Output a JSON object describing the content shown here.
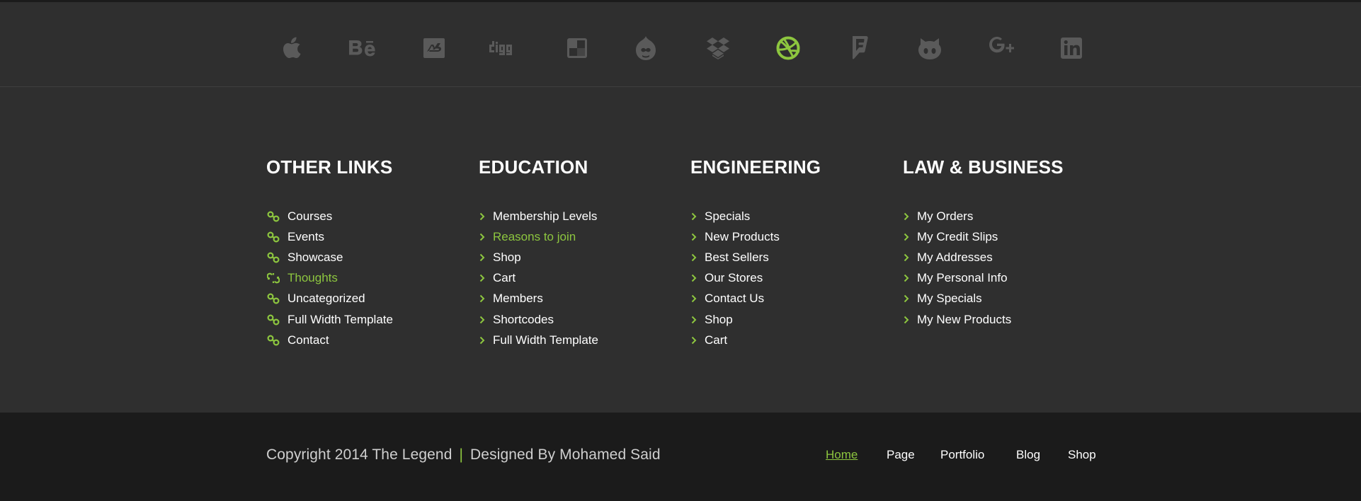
{
  "social": {
    "colors": {
      "default": "#5a5a5a",
      "active": "#8dc63f"
    },
    "icons": [
      {
        "name": "apple-icon",
        "active": false
      },
      {
        "name": "behance-icon",
        "active": false
      },
      {
        "name": "deviantart-icon",
        "active": false
      },
      {
        "name": "digg-icon",
        "active": false
      },
      {
        "name": "delicious-icon",
        "active": false
      },
      {
        "name": "drupal-icon",
        "active": false
      },
      {
        "name": "dropbox-icon",
        "active": false
      },
      {
        "name": "dribbble-icon",
        "active": true
      },
      {
        "name": "foursquare-icon",
        "active": false
      },
      {
        "name": "github-icon",
        "active": false
      },
      {
        "name": "google-plus-icon",
        "active": false
      },
      {
        "name": "linkedin-icon",
        "active": false
      }
    ]
  },
  "columns": [
    {
      "title": "OTHER LINKS",
      "icon": "chain-link-icon",
      "items": [
        {
          "label": "Courses",
          "active": false
        },
        {
          "label": "Events",
          "active": false
        },
        {
          "label": "Showcase",
          "active": false
        },
        {
          "label": "Thoughts",
          "active": true
        },
        {
          "label": "Uncategorized",
          "active": false
        },
        {
          "label": "Full Width Template",
          "active": false
        },
        {
          "label": "Contact",
          "active": false
        }
      ]
    },
    {
      "title": "EDUCATION",
      "icon": "chevron-right-icon",
      "items": [
        {
          "label": "Membership Levels",
          "active": false
        },
        {
          "label": "Reasons to join",
          "active": true
        },
        {
          "label": "Shop",
          "active": false
        },
        {
          "label": "Cart",
          "active": false
        },
        {
          "label": "Members",
          "active": false
        },
        {
          "label": "Shortcodes",
          "active": false
        },
        {
          "label": "Full Width Template",
          "active": false
        }
      ]
    },
    {
      "title": "ENGINEERING",
      "icon": "chevron-right-icon",
      "items": [
        {
          "label": "Specials",
          "active": false
        },
        {
          "label": "New Products",
          "active": false
        },
        {
          "label": "Best Sellers",
          "active": false
        },
        {
          "label": "Our Stores",
          "active": false
        },
        {
          "label": "Contact Us",
          "active": false
        },
        {
          "label": "Shop",
          "active": false
        },
        {
          "label": "Cart",
          "active": false
        }
      ]
    },
    {
      "title": "LAW & BUSINESS",
      "icon": "chevron-right-icon",
      "items": [
        {
          "label": "My Orders",
          "active": false
        },
        {
          "label": "My Credit Slips",
          "active": false
        },
        {
          "label": "My Addresses",
          "active": false
        },
        {
          "label": "My Personal Info",
          "active": false
        },
        {
          "label": "My Specials",
          "active": false
        },
        {
          "label": "My New Products",
          "active": false
        }
      ]
    }
  ],
  "footer": {
    "copyright": "Copyright 2014 The Legend",
    "separator": "|",
    "credit": "Designed By Mohamed Said",
    "nav": [
      {
        "label": "Home",
        "active": true
      },
      {
        "label": "Page",
        "active": false
      },
      {
        "label": "Portfolio",
        "active": false
      },
      {
        "label": "Blog",
        "active": false
      },
      {
        "label": "Shop",
        "active": false
      }
    ]
  },
  "colors": {
    "accent": "#8dc63f",
    "background": "#2f2f2f",
    "bottom_bar": "#1b1b1b",
    "icon_gray": "#5a5a5a"
  }
}
